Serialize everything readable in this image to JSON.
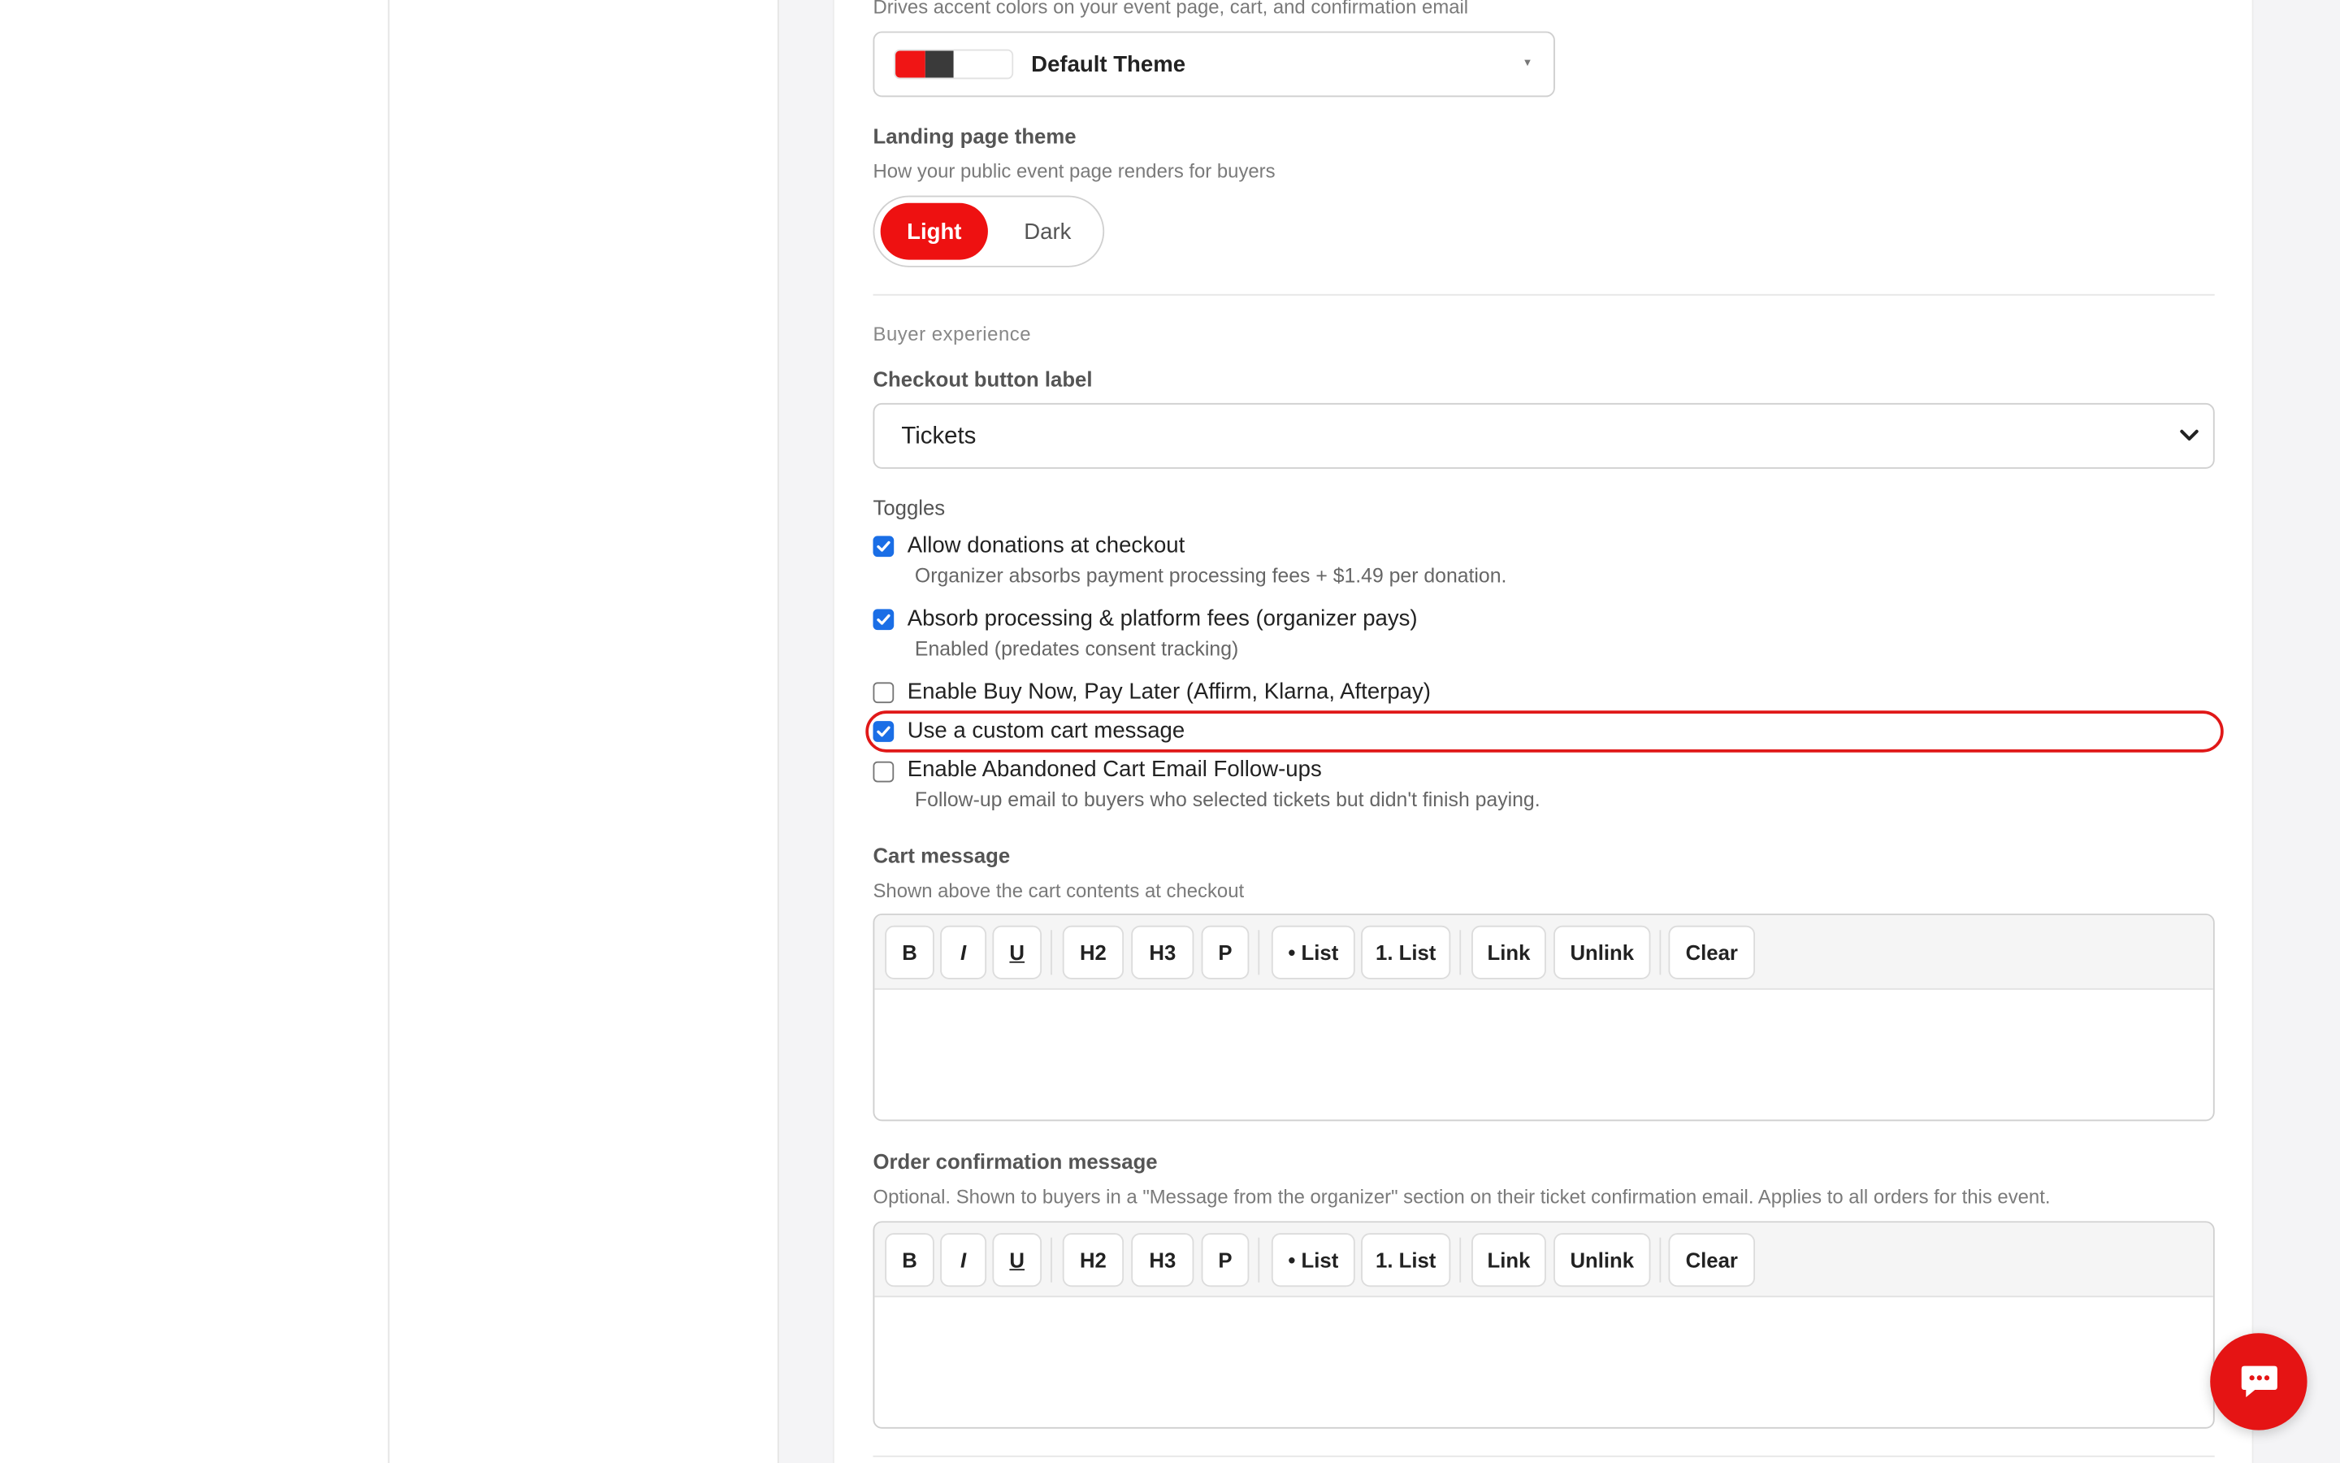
{
  "theme": {
    "hint": "Drives accent colors on your event page, cart, and confirmation email",
    "selected": "Default Theme",
    "swatch_colors": [
      "#f01515",
      "#3a3a3a",
      "#ffffff",
      "#ffffff"
    ]
  },
  "landing": {
    "label": "Landing page theme",
    "hint": "How your public event page renders for buyers",
    "options": [
      "Light",
      "Dark"
    ],
    "selected": "Light"
  },
  "buyer_experience": {
    "section_title": "Buyer experience",
    "checkout_label": "Checkout button label",
    "checkout_value": "Tickets"
  },
  "toggles": {
    "title": "Toggles",
    "items": [
      {
        "label": "Allow donations at checkout",
        "sub": "Organizer absorbs payment processing fees + $1.49 per donation.",
        "checked": true
      },
      {
        "label": "Absorb processing & platform fees (organizer pays)",
        "sub": "Enabled (predates consent tracking)",
        "checked": true
      },
      {
        "label": "Enable Buy Now, Pay Later (Affirm, Klarna, Afterpay)",
        "checked": false
      },
      {
        "label": "Use a custom cart message",
        "checked": true
      },
      {
        "label": "Enable Abandoned Cart Email Follow-ups",
        "sub": "Follow-up email to buyers who selected tickets but didn't finish paying.",
        "checked": false
      }
    ]
  },
  "cart_message": {
    "label": "Cart message",
    "hint": "Shown above the cart contents at checkout"
  },
  "order_confirmation": {
    "label": "Order confirmation message",
    "hint": "Optional. Shown to buyers in a \"Message from the organizer\" section on their ticket confirmation email. Applies to all orders for this event."
  },
  "toolbar": {
    "bold": "B",
    "italic": "I",
    "underline": "U",
    "h2": "H2",
    "h3": "H3",
    "p": "P",
    "bullet_list": "• List",
    "numbered_list": "1. List",
    "link": "Link",
    "unlink": "Unlink",
    "clear": "Clear"
  },
  "colors": {
    "accent": "#ee1111",
    "checkbox": "#1a6ee6",
    "highlight": "#e01818"
  }
}
